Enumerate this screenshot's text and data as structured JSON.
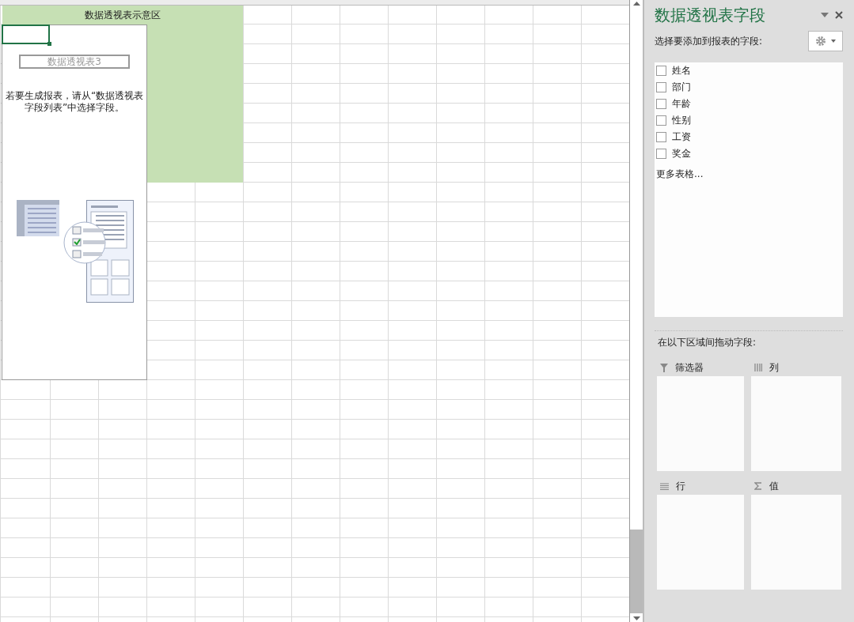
{
  "sheet": {
    "title_cell": "数据透视表示意区",
    "pivot_placeholder": {
      "name": "数据透视表3",
      "instructions": "若要生成报表，请从“数据透视表字段列表”中选择字段。"
    }
  },
  "field_pane": {
    "title": "数据透视表字段",
    "subtitle": "选择要添加到报表的字段:",
    "fields": [
      {
        "label": "姓名",
        "checked": false
      },
      {
        "label": "部门",
        "checked": false
      },
      {
        "label": "年龄",
        "checked": false
      },
      {
        "label": "性别",
        "checked": false
      },
      {
        "label": "工资",
        "checked": false
      },
      {
        "label": "奖金",
        "checked": false
      }
    ],
    "more_tables": "更多表格...",
    "areas_label": "在以下区域间拖动字段:",
    "areas": [
      {
        "kind": "filter",
        "label": "筛选器"
      },
      {
        "kind": "columns",
        "label": "列"
      },
      {
        "kind": "rows",
        "label": "行"
      },
      {
        "kind": "values",
        "label": "值"
      }
    ]
  }
}
